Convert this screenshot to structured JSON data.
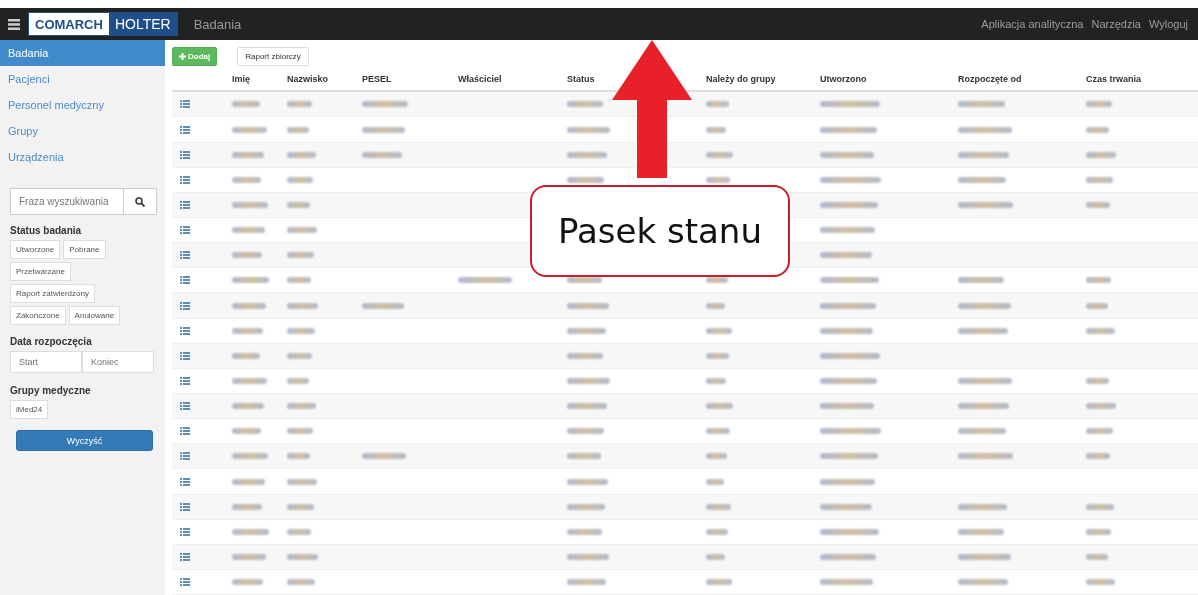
{
  "topbar": {
    "logo_left": "COMARCH",
    "logo_right": "HOLTER",
    "title": "Badania",
    "links": [
      "Aplikacja analityczna",
      "Narzędzia",
      "Wyloguj"
    ]
  },
  "sidebar": {
    "items": [
      {
        "label": "Badania",
        "selected": true
      },
      {
        "label": "Pacjenci",
        "selected": false
      },
      {
        "label": "Personel medyczny",
        "selected": false
      },
      {
        "label": "Grupy",
        "selected": false
      },
      {
        "label": "Urządzenia",
        "selected": false
      }
    ],
    "search": {
      "placeholder": "Fraza wyszukiwania"
    },
    "status_title": "Status badania",
    "status_rows": [
      [
        "Utworzone",
        "Pobrane"
      ],
      [
        "Przetwarzane"
      ],
      [
        "Raport zatwierdzony"
      ],
      [
        "Zakończone",
        "Anulowane"
      ]
    ],
    "date_title": "Data rozpoczęcia",
    "date_start": {
      "placeholder": "Start"
    },
    "date_end": {
      "placeholder": "Koniec"
    },
    "groups_title": "Grupy medyczne",
    "groups": [
      "iMed24"
    ],
    "clear_button": "Wyczyść"
  },
  "toolbar": {
    "add_button": "Dodaj",
    "report_button": "Raport zbiorczy"
  },
  "table": {
    "columns": [
      "Imię",
      "Nazwisko",
      "PESEL",
      "Właściciel",
      "Status",
      "Należy do grupy",
      "Utworzono",
      "Rozpoczęte od",
      "Czas trwania"
    ],
    "rows": [
      {
        "kind": "full"
      },
      {
        "kind": "full"
      },
      {
        "kind": "full"
      },
      {
        "kind": "nopesel"
      },
      {
        "kind": "covered"
      },
      {
        "kind": "shortcovered"
      },
      {
        "kind": "short"
      },
      {
        "kind": "owner"
      },
      {
        "kind": "full"
      },
      {
        "kind": "nopesel"
      },
      {
        "kind": "short"
      },
      {
        "kind": "nopesel"
      },
      {
        "kind": "nopesel"
      },
      {
        "kind": "nopesel"
      },
      {
        "kind": "full"
      },
      {
        "kind": "short"
      },
      {
        "kind": "nopesel"
      },
      {
        "kind": "nopesel"
      },
      {
        "kind": "nopesel"
      },
      {
        "kind": "nopesel"
      }
    ]
  },
  "annotation": {
    "callout": "Pasek stanu"
  }
}
